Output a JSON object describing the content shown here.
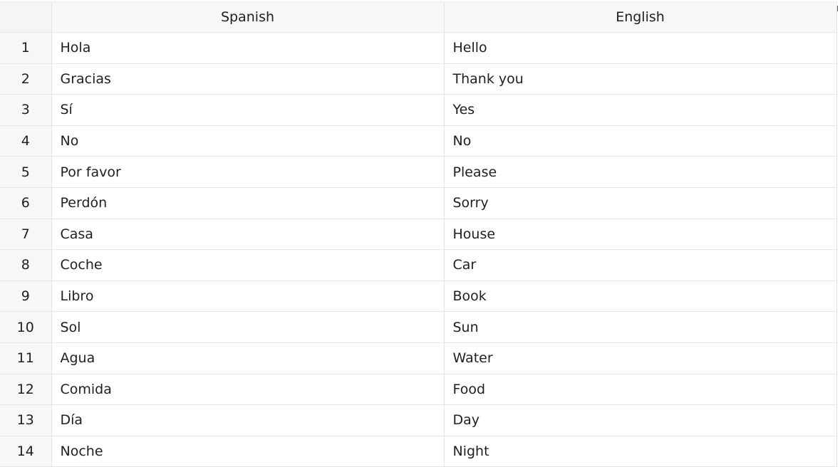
{
  "table": {
    "columns": [
      "Spanish",
      "English"
    ],
    "rows": [
      {
        "n": "1",
        "spanish": "Hola",
        "english": "Hello"
      },
      {
        "n": "2",
        "spanish": "Gracias",
        "english": "Thank you"
      },
      {
        "n": "3",
        "spanish": "Sí",
        "english": "Yes"
      },
      {
        "n": "4",
        "spanish": "No",
        "english": "No"
      },
      {
        "n": "5",
        "spanish": "Por favor",
        "english": "Please"
      },
      {
        "n": "6",
        "spanish": "Perdón",
        "english": "Sorry"
      },
      {
        "n": "7",
        "spanish": "Casa",
        "english": "House"
      },
      {
        "n": "8",
        "spanish": "Coche",
        "english": "Car"
      },
      {
        "n": "9",
        "spanish": "Libro",
        "english": "Book"
      },
      {
        "n": "10",
        "spanish": "Sol",
        "english": "Sun"
      },
      {
        "n": "11",
        "spanish": "Agua",
        "english": "Water"
      },
      {
        "n": "12",
        "spanish": "Comida",
        "english": "Food"
      },
      {
        "n": "13",
        "spanish": "Día",
        "english": "Day"
      },
      {
        "n": "14",
        "spanish": "Noche",
        "english": "Night"
      }
    ]
  }
}
